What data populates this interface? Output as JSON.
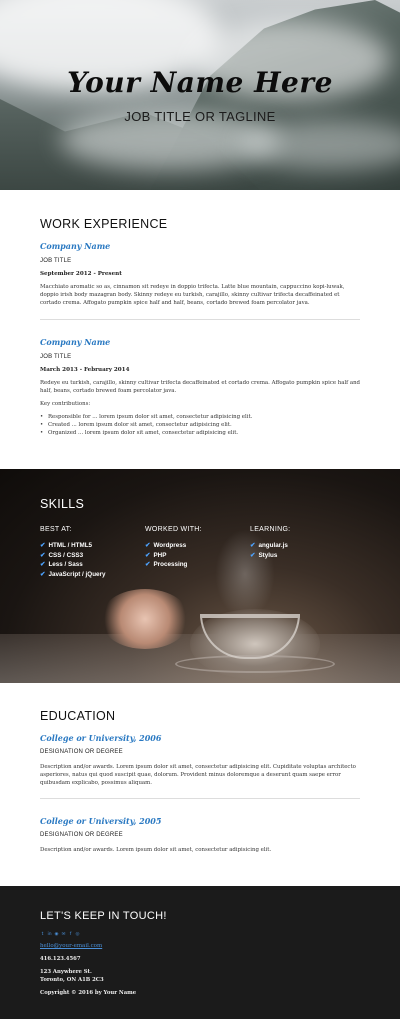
{
  "header": {
    "name": "Your Name Here",
    "tagline": "JOB TITLE OR TAGLINE"
  },
  "work": {
    "heading": "WORK EXPERIENCE",
    "jobs": [
      {
        "company": "Company Name",
        "title": "JOB TITLE",
        "dates": "September 2012 - Present",
        "description": "Macchiato aromatic so as, cinnamon sit redeye in doppio trifecta. Latte blue mountain, cappuccino kopi-luwak, doppio irish body mazagran body. Skinny redeye eu turkish, carajillo, skinny cultivar trifecta decaffeinated et cortado crema. Affogato pumpkin spice half and half, beans, cortado brewed foam percolator java."
      },
      {
        "company": "Company Name",
        "title": "JOB TITLE",
        "dates": "March 2013 - February 2014",
        "description": "Redeye eu turkish, carajillo, skinny cultivar trifecta decaffeinated et cortado crema. Affogato pumpkin spice half and half, beans, cortado brewed foam percolator java.",
        "contributions_label": "Key contributions:",
        "contributions": [
          "Responsible for ... lorem ipsum dolor sit amet, consectetur adipisicing elit.",
          "Created ... lorem ipsum dolor sit amet, consectetur adipisicing elit.",
          "Organized ... lorem ipsum dolor sit amet, consectetur adipisicing elit."
        ]
      }
    ]
  },
  "skills": {
    "heading": "SKILLS",
    "columns": [
      {
        "heading": "BEST AT:",
        "items": [
          "HTML / HTML5",
          "CSS / CSS3",
          "Less / Sass",
          "JavaScript / jQuery"
        ]
      },
      {
        "heading": "WORKED WITH:",
        "items": [
          "Wordpress",
          "PHP",
          "Processing"
        ]
      },
      {
        "heading": "LEARNING:",
        "items": [
          "angular.js",
          "Stylus"
        ]
      }
    ],
    "check_icon": "check-icon",
    "accent": "#4da3ff"
  },
  "education": {
    "heading": "EDUCATION",
    "entries": [
      {
        "school": "College or University, 2006",
        "degree": "DESIGNATION OR DEGREE",
        "description": "Description and/or awards. Lorem ipsum dolor sit amet, consectetur adipisicing elit. Cupiditate voluptas architecto asperiores, natus qui quod suscipit quae, dolorum. Provident minus doloremque a deserunt quam saepe error quibusdam explicabo, possimus aliquam."
      },
      {
        "school": "College or University, 2005",
        "degree": "DESIGNATION OR DEGREE",
        "description": "Description and/or awards. Lorem ipsum dolor sit amet, consectetur adipisicing elit."
      }
    ]
  },
  "contact": {
    "heading": "LET'S KEEP IN TOUCH!",
    "social_icons": [
      "twitter-icon",
      "linkedin-icon",
      "github-icon",
      "email-icon",
      "facebook-icon",
      "dribbble-icon"
    ],
    "email": "hello@your-email.com",
    "phone": "416.123.4567",
    "address_line1": "123 Anywhere St.",
    "address_line2": "Toronto, ON A1B 2C3",
    "copyright": "Copyright © 2016 by Your Name",
    "link_color": "#4a90d9"
  }
}
